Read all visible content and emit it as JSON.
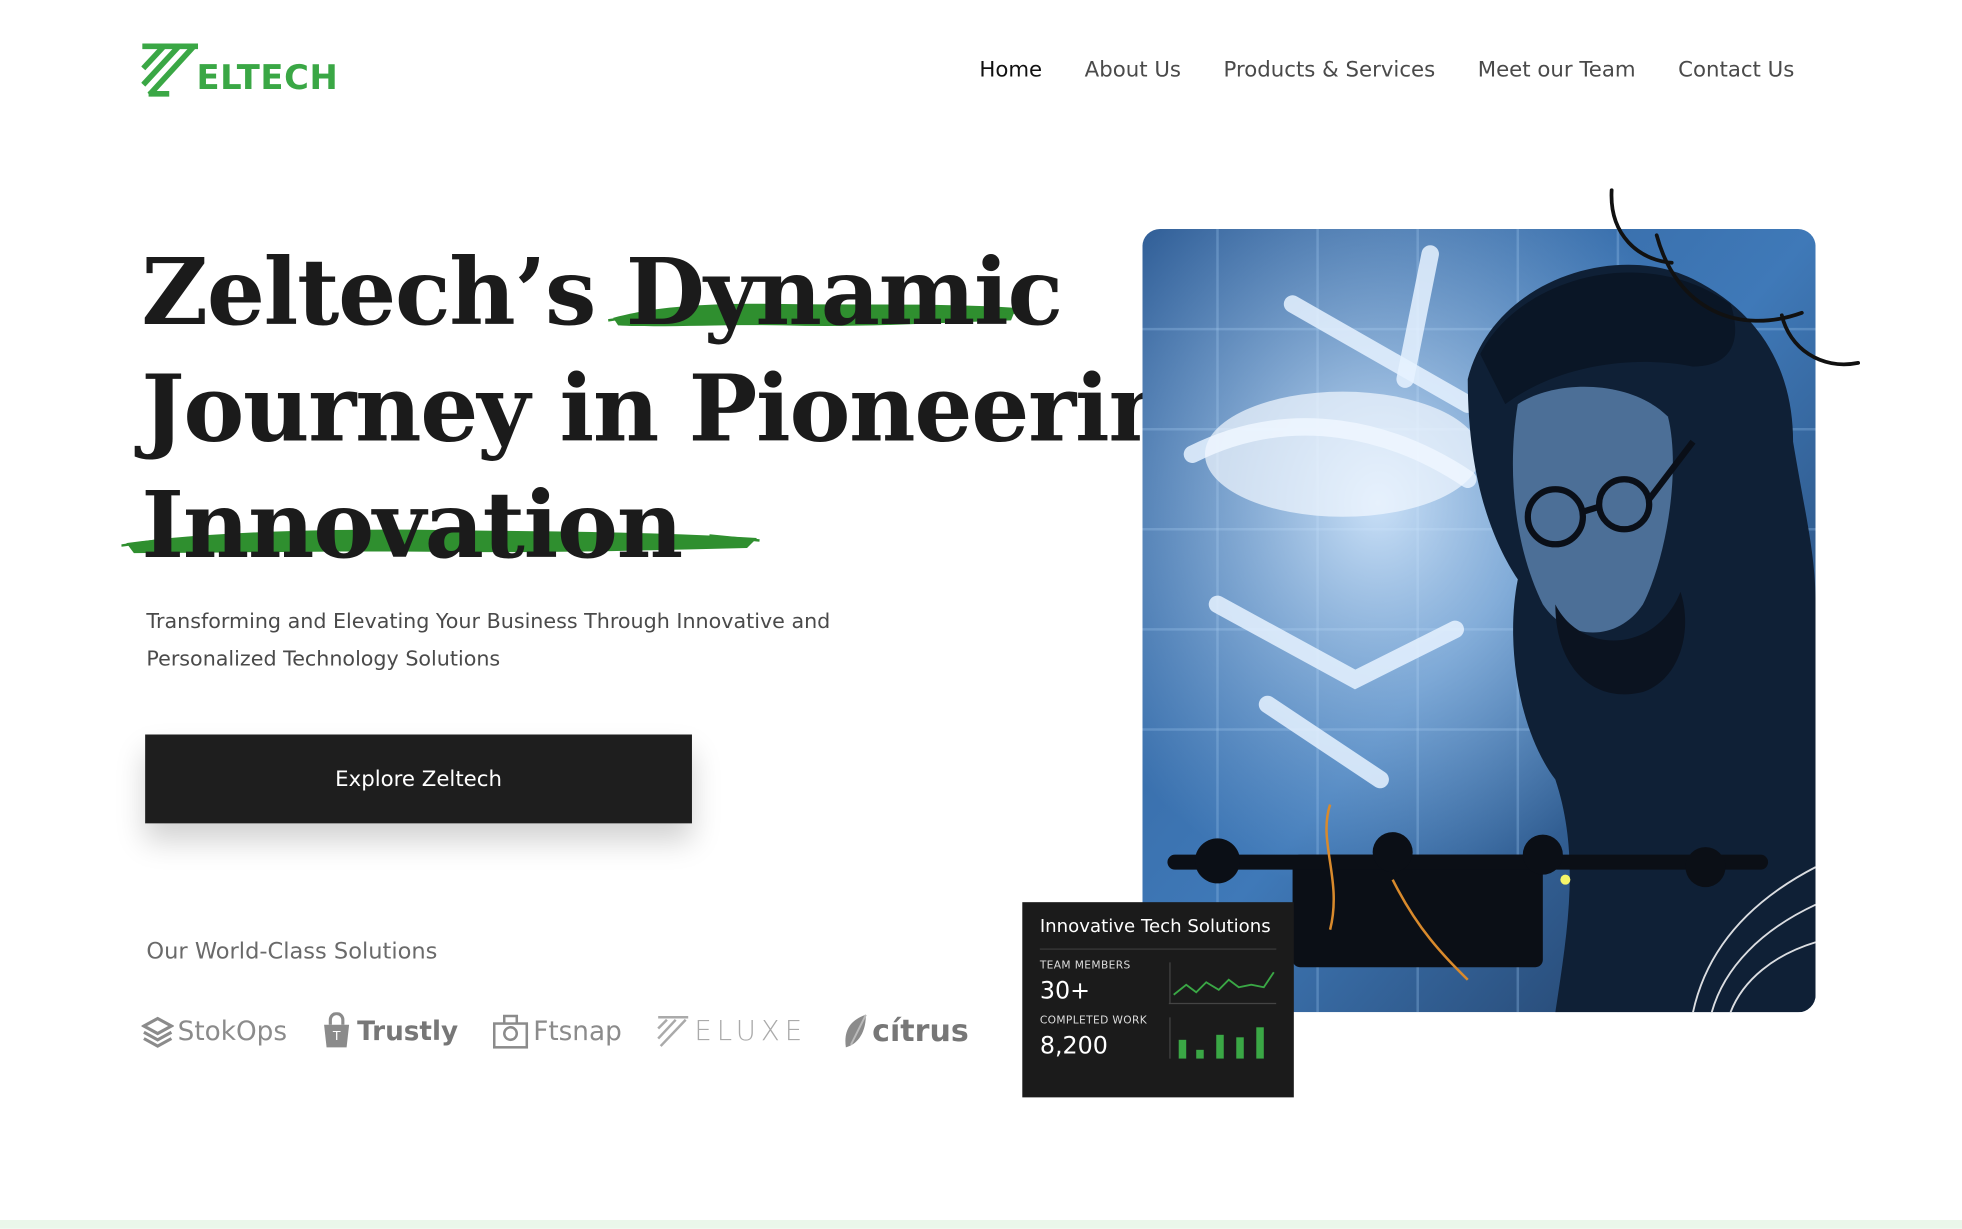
{
  "brand": {
    "name": "ELTECH",
    "accent_color": "#3aa745",
    "icon": "zeltech-logo-mark"
  },
  "nav": {
    "items": [
      {
        "label": "Home",
        "active": true
      },
      {
        "label": "About Us",
        "active": false
      },
      {
        "label": "Products & Services",
        "active": false
      },
      {
        "label": "Meet our Team",
        "active": false
      },
      {
        "label": "Contact Us",
        "active": false
      }
    ]
  },
  "hero": {
    "headline": {
      "line1_a": "Zeltech’s",
      "line1_b": "Dynamic",
      "line2": "Journey in Pioneering",
      "line3": "Innovation"
    },
    "subtitle": "Transforming and Elevating Your Business Through Innovative and Personalized Technology Solutions",
    "cta_label": "Explore Zeltech",
    "highlight_color": "#2e8b2e"
  },
  "solutions": {
    "label": "Our World-Class Solutions",
    "partners": [
      {
        "name": "StokOps",
        "icon": "stack-icon"
      },
      {
        "name": "Trustly",
        "icon": "bag-icon"
      },
      {
        "name": "Ftsnap",
        "icon": "camera-icon"
      },
      {
        "name": "ELUXE",
        "icon": "stripes-z-icon"
      },
      {
        "name": "cítrus",
        "icon": "citrus-leaf-icon"
      }
    ]
  },
  "stats_card": {
    "title": "Innovative Tech Solutions",
    "team_label": "TEAM MEMBERS",
    "team_value": "30+",
    "work_label": "COMPLETED WORK",
    "work_value": "8,200"
  }
}
